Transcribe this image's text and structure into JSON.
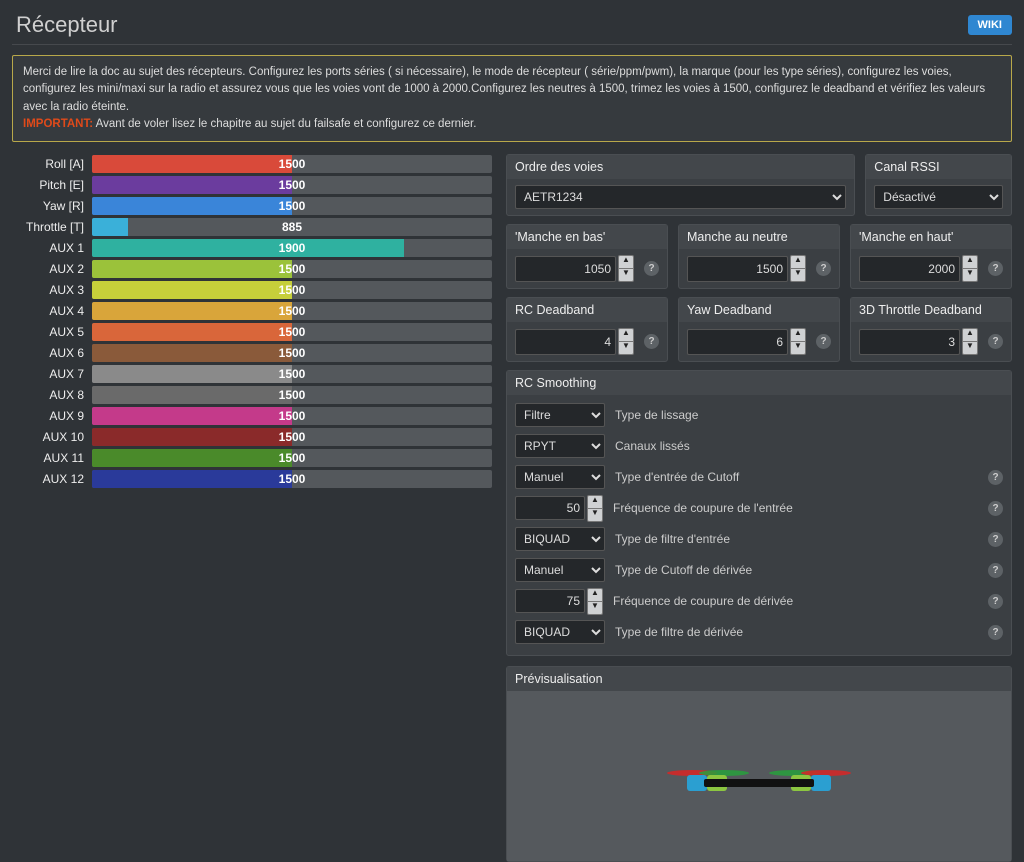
{
  "header": {
    "title": "Récepteur",
    "wiki": "WIKI"
  },
  "warning": {
    "line1": "Merci de lire la doc au sujet des récepteurs. Configurez les ports séries ( si nécessaire), le mode de récepteur ( série/ppm/pwm), la marque (pour les type séries), configurez les voies, configurez les mini/maxi sur la radio et assurez vous que les voies vont de 1000 à 2000.Configurez les neutres à 1500, trimez les voies à 1500, configurez le deadband et vérifiez les valeurs avec la radio éteinte.",
    "important_tag": "IMPORTANT:",
    "line2": "Avant de voler lisez le chapitre au sujet du failsafe et configurez ce dernier."
  },
  "channels": [
    {
      "label": "Roll [A]",
      "value": 1500,
      "pct": 50,
      "color": "#d94a3a"
    },
    {
      "label": "Pitch [E]",
      "value": 1500,
      "pct": 50,
      "color": "#6b3c9e"
    },
    {
      "label": "Yaw [R]",
      "value": 1500,
      "pct": 50,
      "color": "#3a85d9"
    },
    {
      "label": "Throttle [T]",
      "value": 885,
      "pct": 9,
      "color": "#3ab0d9"
    },
    {
      "label": "AUX 1",
      "value": 1900,
      "pct": 78,
      "color": "#2fb1a0"
    },
    {
      "label": "AUX 2",
      "value": 1500,
      "pct": 50,
      "color": "#9bc23a"
    },
    {
      "label": "AUX 3",
      "value": 1500,
      "pct": 50,
      "color": "#c6cf3a"
    },
    {
      "label": "AUX 4",
      "value": 1500,
      "pct": 50,
      "color": "#d9a53a"
    },
    {
      "label": "AUX 5",
      "value": 1500,
      "pct": 50,
      "color": "#d9663a"
    },
    {
      "label": "AUX 6",
      "value": 1500,
      "pct": 50,
      "color": "#8a5a3a"
    },
    {
      "label": "AUX 7",
      "value": 1500,
      "pct": 50,
      "color": "#8a8a8a"
    },
    {
      "label": "AUX 8",
      "value": 1500,
      "pct": 50,
      "color": "#6a6a6a"
    },
    {
      "label": "AUX 9",
      "value": 1500,
      "pct": 50,
      "color": "#c43a8a"
    },
    {
      "label": "AUX 10",
      "value": 1500,
      "pct": 50,
      "color": "#8a2a2a"
    },
    {
      "label": "AUX 11",
      "value": 1500,
      "pct": 50,
      "color": "#4a8a2a"
    },
    {
      "label": "AUX 12",
      "value": 1500,
      "pct": 50,
      "color": "#2a3a9a"
    }
  ],
  "order": {
    "title": "Ordre des voies",
    "value": "AETR1234"
  },
  "rssi": {
    "title": "Canal RSSI",
    "value": "Désactivé"
  },
  "stick": {
    "low": {
      "title": "'Manche en bas'",
      "value": 1050
    },
    "mid": {
      "title": "Manche au neutre",
      "value": 1500
    },
    "high": {
      "title": "'Manche en haut'",
      "value": 2000
    }
  },
  "deadband": {
    "rc": {
      "title": "RC Deadband",
      "value": 4
    },
    "yaw": {
      "title": "Yaw Deadband",
      "value": 6
    },
    "thr": {
      "title": "3D Throttle Deadband",
      "value": 3
    }
  },
  "smoothing": {
    "title": "RC Smoothing",
    "rows": [
      {
        "kind": "select",
        "value": "Filtre",
        "label": "Type de lissage",
        "help": false
      },
      {
        "kind": "select",
        "value": "RPYT",
        "label": "Canaux lissés",
        "help": false
      },
      {
        "kind": "select",
        "value": "Manuel",
        "label": "Type d'entrée de Cutoff",
        "help": true
      },
      {
        "kind": "number",
        "value": 50,
        "label": "Fréquence de coupure de l'entrée",
        "help": true
      },
      {
        "kind": "select",
        "value": "BIQUAD",
        "label": "Type de filtre d'entrée",
        "help": true
      },
      {
        "kind": "select",
        "value": "Manuel",
        "label": "Type de Cutoff de dérivée",
        "help": true
      },
      {
        "kind": "number",
        "value": 75,
        "label": "Fréquence de coupure de dérivée",
        "help": true
      },
      {
        "kind": "select",
        "value": "BIQUAD",
        "label": "Type de filtre de dérivée",
        "help": true
      }
    ]
  },
  "preview": {
    "title": "Prévisualisation"
  }
}
